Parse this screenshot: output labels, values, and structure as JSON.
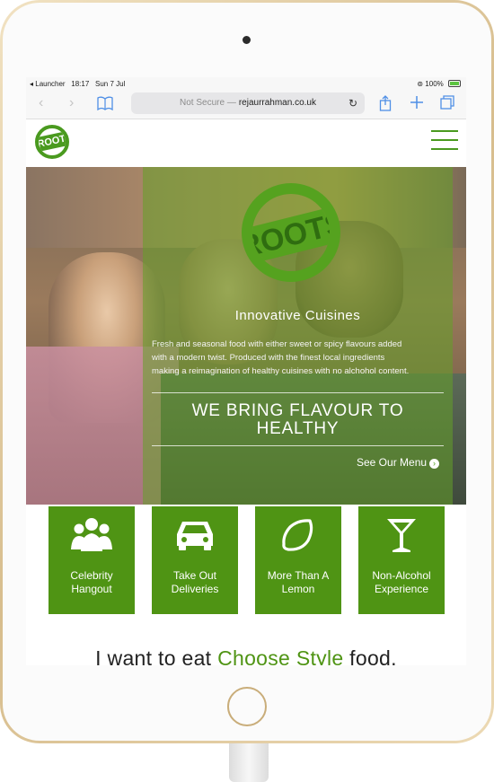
{
  "status_bar": {
    "back_app": "◂ Launcher",
    "time": "18:17",
    "date": "Sun 7 Jul",
    "battery_text": "100%"
  },
  "browser": {
    "url_prefix": "Not Secure —",
    "url_domain": "rejaurrahman.co.uk",
    "icons": [
      "back-icon",
      "forward-icon",
      "bookmarks-icon",
      "reload-icon",
      "share-icon",
      "new-tab-icon",
      "tabs-icon"
    ]
  },
  "site": {
    "logo_text": "ROOTS",
    "brand_color": "#4f9414",
    "hero": {
      "logo_text": "ROOTS",
      "subtitle": "Innovative Cuisines",
      "body_lines": [
        "Fresh and seasonal food with either sweet or spicy flavours added",
        "with a modern twist. Produced with the finest local ingredients",
        "making a reimagination of healthy cuisines with no alchohol content."
      ],
      "headline": "WE BRING FLAVOUR TO HEALTHY",
      "cta": "See Our Menu"
    },
    "features": [
      {
        "icon": "people-icon",
        "label": "Celebrity Hangout"
      },
      {
        "icon": "car-icon",
        "label": "Take Out Deliveries"
      },
      {
        "icon": "lemon-icon",
        "label": "More Than A Lemon"
      },
      {
        "icon": "cocktail-icon",
        "label": "Non-Alcohol Experience"
      }
    ],
    "tagline": {
      "prefix": "I want to eat",
      "highlight": "Choose Style",
      "suffix": "food."
    }
  }
}
